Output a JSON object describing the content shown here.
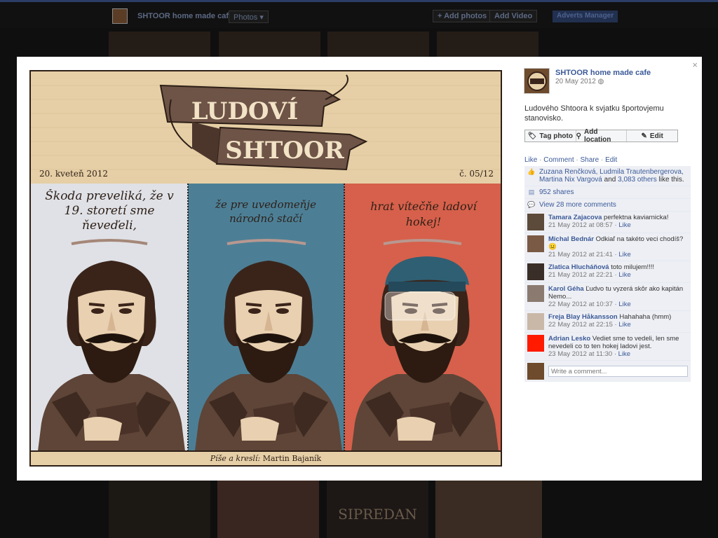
{
  "background": {
    "page_title": "SHTOOR home made cafe",
    "section_dropdown": "Photos",
    "add_photos_label": "+ Add photos",
    "add_video_label": "Add Video",
    "adverts_label": "Adverts Manager",
    "bottom_thumb_text": "SIPREDAN"
  },
  "lightbox": {
    "close_label": "×",
    "photo": {
      "banner_line1": "LUDOVÍ",
      "banner_line2": "SHTOOR",
      "date": "20. kveteň 2012",
      "issue": "č. 05/12",
      "panels": [
        {
          "text": "Škoda preveliká, že v 19. storetí sme ňeveďeli,",
          "color": "#dfe1e6"
        },
        {
          "text": "že pre uvedomeňje národnô stačí",
          "color": "#4c7f96"
        },
        {
          "text": "hrat vítečňe ladoví hokej!",
          "color": "#d6604b"
        }
      ],
      "credit_prefix": "Píše a kreslí:",
      "credit_name": "Martin Bajaník"
    },
    "sidebar": {
      "page_name": "SHTOOR home made cafe",
      "post_date": "20 May 2012",
      "caption": "Ludového Shtoora k svjatku športovjemu stanovisko.",
      "actions": [
        {
          "label": "Tag photo",
          "icon": "tag-icon"
        },
        {
          "label": "Add location",
          "icon": "location-pin-icon"
        },
        {
          "label": "Edit",
          "icon": "pencil-icon"
        }
      ],
      "links": {
        "like": "Like",
        "comment": "Comment",
        "share": "Share",
        "edit": "Edit"
      },
      "likes_text_people": "Zuzana Renčková, Ludmila Trautenbergerova, Martina Nix Vargová",
      "likes_text_and": "and",
      "likes_others": "3,083 others",
      "likes_suffix": "like this.",
      "shares": "952 shares",
      "view_comments": "View 28 more comments",
      "comments": [
        {
          "author": "Tamara Zajacova",
          "text": "perfektna kaviarnicka!",
          "time": "21 May 2012 at 08:57",
          "avatar_color": "#5c4a3a"
        },
        {
          "author": "Michal Bednár",
          "text": "Odkiaľ na takéto veci chodíš? 😐",
          "time": "21 May 2012 at 21:41",
          "avatar_color": "#7a5a45"
        },
        {
          "author": "Zlatica Hlucháňová",
          "text": "toto milujem!!!!",
          "time": "21 May 2012 at 22:21",
          "avatar_color": "#3a2e28"
        },
        {
          "author": "Karol Géha",
          "text": "Ľudvo tu vyzerá skôr ako kapitán Nemo...",
          "time": "22 May 2012 at 10:37",
          "avatar_color": "#8a7a70"
        },
        {
          "author": "Freja Blay Håkansson",
          "text": "Hahahaha (hmm)",
          "time": "22 May 2012 at 22:15",
          "avatar_color": "#c9b8a8"
        },
        {
          "author": "Adrian Lesko",
          "text": "Vediet sme to vedeli, len sme nevedeli co to ten hokej ladovi jest.",
          "time": "23 May 2012 at 11:30",
          "avatar_color": "#ff1a00"
        }
      ],
      "like_label": "Like",
      "write_placeholder": "Write a comment..."
    }
  }
}
